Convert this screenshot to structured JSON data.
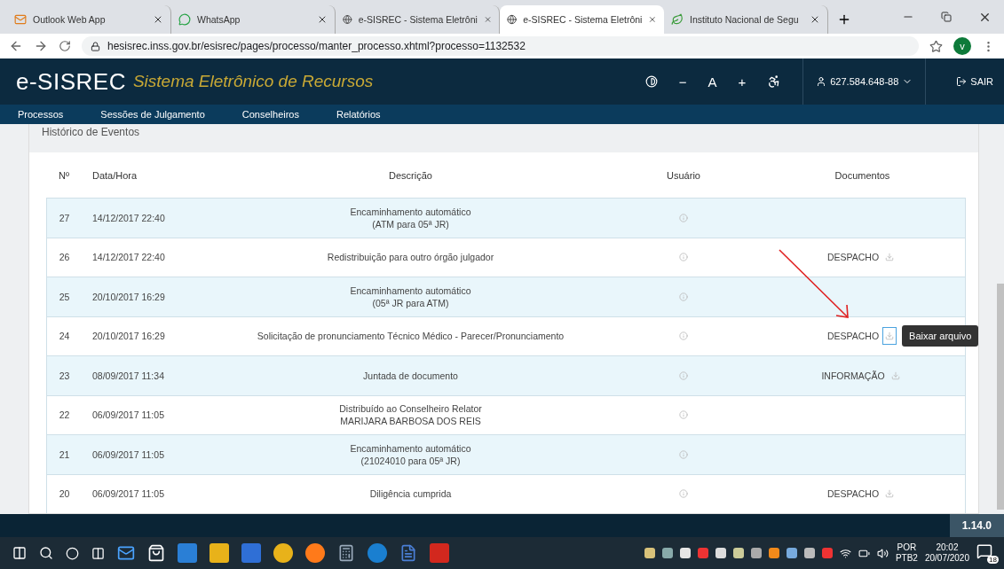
{
  "browser": {
    "tabs": [
      {
        "label": "Outlook Web App",
        "kind": "mail",
        "selected": false
      },
      {
        "label": "WhatsApp",
        "kind": "chat",
        "selected": false
      },
      {
        "label": "e-SISREC - Sistema Eletrôni",
        "kind": "globe",
        "selected": false
      },
      {
        "label": "e-SISREC - Sistema Eletrôni",
        "kind": "globe",
        "selected": true
      },
      {
        "label": "Instituto Nacional de Segu",
        "kind": "leaf",
        "selected": false
      }
    ],
    "url": "hesisrec.inss.gov.br/esisrec/pages/processo/manter_processo.xhtml?processo=1132532",
    "profile_initial": "v"
  },
  "app": {
    "brand": "e-SISREC",
    "subtitle": "Sistema Eletrônico de Recursos",
    "tools": [
      "−",
      "A",
      "+"
    ],
    "user": "627.584.648-88",
    "logout": "SAIR",
    "nav": [
      "Processos",
      "Sessões de Julgamento",
      "Conselheiros",
      "Relatórios"
    ]
  },
  "panel": {
    "title": "Histórico de Eventos",
    "columns": [
      "Nº",
      "Data/Hora",
      "Descrição",
      "Usuário",
      "Documentos"
    ],
    "rows": [
      {
        "n": "27",
        "datetime": "14/12/2017 22:40",
        "description": [
          "Encaminhamento automático",
          "(ATM para 05ª JR)"
        ]
      },
      {
        "n": "26",
        "datetime": "14/12/2017 22:40",
        "description": [
          "Redistribuição para outro órgão julgador"
        ],
        "document": {
          "label": "DESPACHO",
          "focused": false
        }
      },
      {
        "n": "25",
        "datetime": "20/10/2017 16:29",
        "description": [
          "Encaminhamento automático",
          "(05ª JR para ATM)"
        ]
      },
      {
        "n": "24",
        "datetime": "20/10/2017 16:29",
        "description": [
          "Solicitação de pronunciamento Técnico Médico - Parecer/Pronunciamento"
        ],
        "document": {
          "label": "DESPACHO",
          "focused": true,
          "tooltip": "Baixar arquivo"
        }
      },
      {
        "n": "23",
        "datetime": "08/09/2017 11:34",
        "description": [
          "Juntada de documento"
        ],
        "document": {
          "label": "INFORMAÇÃO",
          "focused": false
        }
      },
      {
        "n": "22",
        "datetime": "06/09/2017 11:05",
        "description": [
          "Distribuído ao Conselheiro Relator",
          "MARIJARA BARBOSA DOS REIS"
        ]
      },
      {
        "n": "21",
        "datetime": "06/09/2017 11:05",
        "description": [
          "Encaminhamento automático",
          "(21024010 para 05ª JR)"
        ]
      },
      {
        "n": "20",
        "datetime": "06/09/2017 11:05",
        "description": [
          "Diligência cumprida"
        ],
        "document": {
          "label": "DESPACHO",
          "focused": false
        }
      }
    ]
  },
  "version": "1.14.0",
  "taskbar": {
    "language": "POR",
    "layout": "PTB2",
    "time": "20:02",
    "date": "20/07/2020",
    "notifications": "18"
  }
}
